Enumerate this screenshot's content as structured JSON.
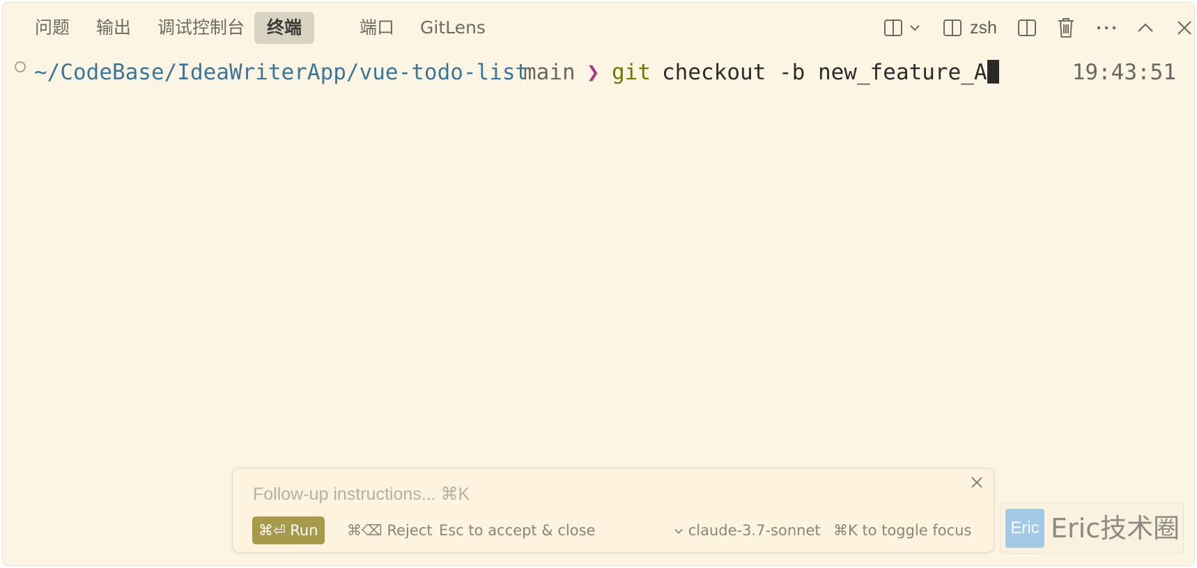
{
  "tabs": [
    {
      "label": "问题",
      "active": false
    },
    {
      "label": "输出",
      "active": false
    },
    {
      "label": "调试控制台",
      "active": false
    },
    {
      "label": "终端",
      "active": true
    },
    {
      "label": "端口",
      "active": false
    },
    {
      "label": "GitLens",
      "active": false
    }
  ],
  "toolbar": {
    "shell_label": "zsh",
    "icons": [
      "split-layout-icon",
      "chevron-down-icon",
      "terminal-split-icon",
      "split-editor-icon",
      "trash-icon",
      "more-icon",
      "chevron-up-icon",
      "close-icon"
    ]
  },
  "terminal": {
    "path": "~/CodeBase/IdeaWriterApp/vue-todo-list",
    "branch": "main",
    "prompt_symbol": "❯",
    "command": "git",
    "args": "checkout -b new_feature_A",
    "time": "19:43:51"
  },
  "followup": {
    "placeholder": "Follow-up instructions... ⌘K",
    "run_label": "⌘⏎ Run",
    "reject_label": "⌘⌫ Reject",
    "accept_label": "Esc to accept & close",
    "model_label": "claude-3.7-sonnet",
    "toggle_focus_label": "⌘K to toggle focus"
  },
  "watermark": {
    "logo_text": "Eric",
    "text": "Eric技术圈"
  },
  "colors": {
    "background": "#fdf5e4",
    "path": "#3d7596",
    "prompt_symbol": "#b1377c",
    "command": "#6c7a00",
    "run_button": "#a89a4c"
  }
}
